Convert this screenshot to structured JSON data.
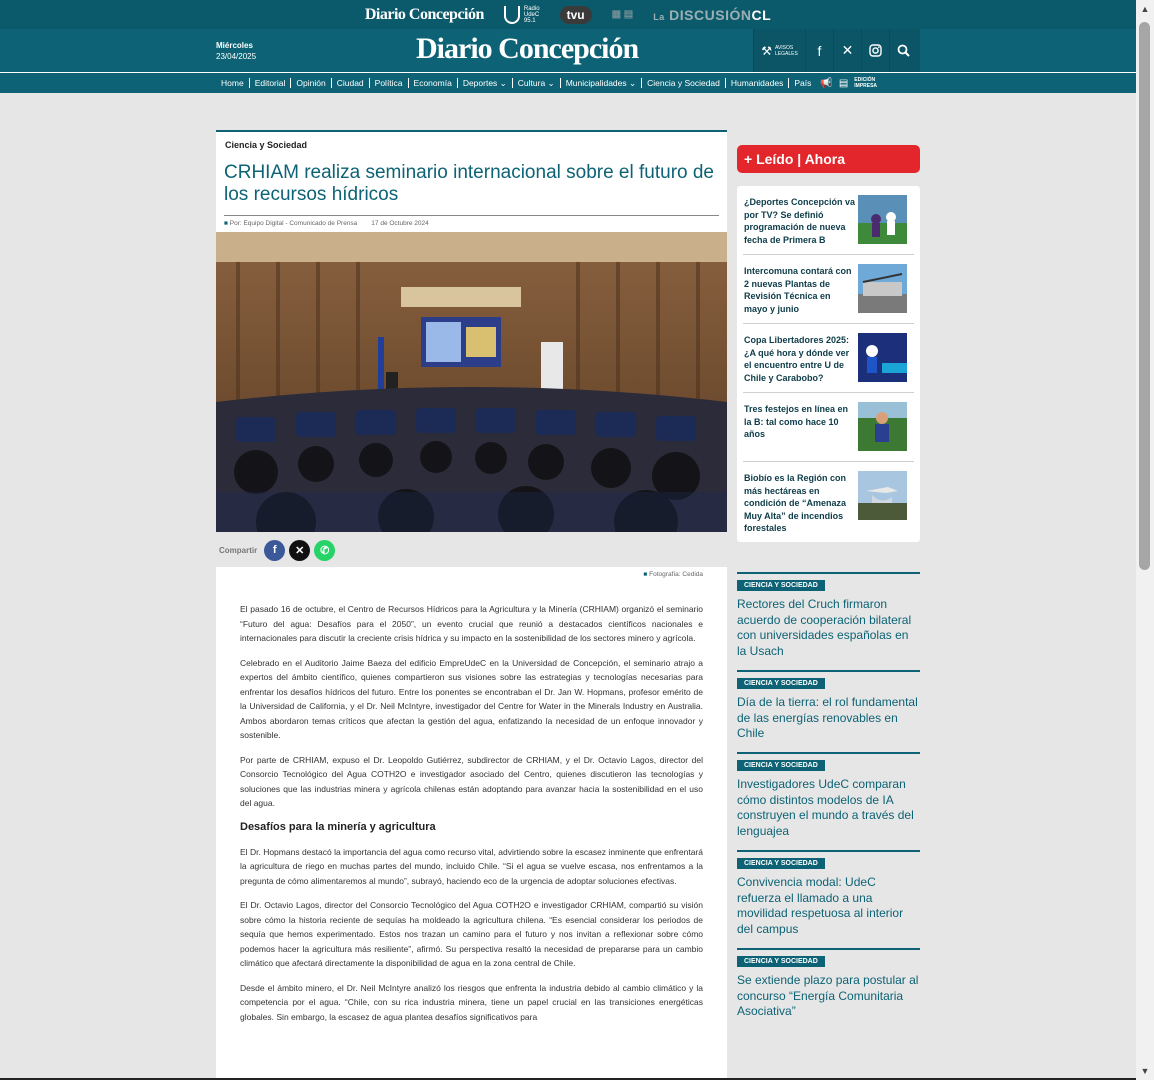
{
  "network": {
    "brand": "Diario Concepción",
    "radio": "Radio UdeC 95.1",
    "radio_l1": "Radio",
    "radio_l2": "UdeC",
    "radio_l3": "95.1",
    "tvu": "tvu",
    "discusion_prefix": "La",
    "discusion_main": "DISCUSIÓN",
    "discusion_suffix": "CL"
  },
  "header": {
    "day": "Miércoles",
    "date": "23/04/2025",
    "logo": "Diario Concepción",
    "avisos_l1": "AVISOS",
    "avisos_l2": "LEGALES"
  },
  "nav": {
    "items": [
      "Home",
      "Editorial",
      "Opinión",
      "Ciudad",
      "Política",
      "Economía",
      "Deportes ⌄",
      "Cultura ⌄",
      "Municipalidades ⌄",
      "Ciencia y Sociedad",
      "Humanidades",
      "País"
    ],
    "edicion_l1": "EDICIÓN",
    "edicion_l2": "IMPRESA"
  },
  "article": {
    "category": "Ciencia y Sociedad",
    "title": "CRHIAM realiza seminario internacional sobre el futuro de los recursos hídricos",
    "author": "Por: Equipo Digital - Comunicado de Prensa",
    "date": "17 de Octubre 2024",
    "share_label": "Compartir",
    "photo_credit": "Fotografía: Cedida",
    "p1": "El pasado 16 de octubre, el Centro de Recursos Hídricos para la Agricultura y la Minería (CRHIAM) organizó el seminario “Futuro del agua: Desafíos para el 2050”, un evento crucial que reunió a destacados científicos nacionales e internacionales para discutir la creciente crisis hídrica y su impacto en la sostenibilidad de los sectores minero y agrícola.",
    "p2": "Celebrado en el Auditorio Jaime Baeza del edificio EmpreUdeC en la Universidad de Concepción, el seminario atrajo a expertos del ámbito científico, quienes compartieron sus visiones sobre las estrategias y tecnologías necesarias para enfrentar los desafíos hídricos del futuro. Entre los ponentes se encontraban el Dr. Jan W. Hopmans, profesor emérito de la Universidad de California, y el Dr. Neil McIntyre, investigador del Centre for Water in the Minerals Industry en Australia. Ambos abordaron temas críticos que afectan la gestión del agua, enfatizando la necesidad de un enfoque innovador y sostenible.",
    "p3": "Por parte de CRHIAM, expuso el Dr. Leopoldo Gutiérrez, subdirector de CRHIAM, y el Dr. Octavio Lagos, director del Consorcio Tecnológico del Agua COTH2O e investigador asociado del Centro, quienes discutieron las tecnologías y soluciones que las industrias minera y agrícola chilenas están adoptando para avanzar hacia la sostenibilidad en el uso del agua.",
    "subheading": "Desafíos para la minería y agricultura",
    "p4": "El Dr. Hopmans destacó la importancia del agua como recurso vital, advirtiendo sobre la escasez inminente que enfrentará la agricultura de riego en muchas partes del mundo, incluido Chile. “Si el agua se vuelve escasa, nos enfrentamos a la pregunta de cómo alimentaremos al mundo”, subrayó, haciendo eco de la urgencia de adoptar soluciones efectivas.",
    "p5": "El Dr. Octavio Lagos, director del Consorcio Tecnológico del Agua COTH2O e investigador CRHIAM, compartió su visión sobre cómo la historia reciente de sequías ha moldeado la agricultura chilena. “Es esencial considerar los periodos de sequía que hemos experimentado. Estos nos trazan un camino para el futuro y nos invitan a reflexionar sobre cómo podemos hacer la agricultura más resiliente”, afirmó. Su perspectiva resaltó la necesidad de prepararse para un cambio climático que afectará directamente la disponibilidad de agua en la zona central de Chile.",
    "p6": "Desde el ámbito minero, el Dr. Neil McIntyre analizó los riesgos que enfrenta la industria debido al cambio climático y la competencia por el agua. “Chile, con su rica industria minera, tiene un papel crucial en las transiciones energéticas globales. Sin embargo, la escasez de agua plantea desafíos significativos para"
  },
  "leido": {
    "label": "+ Leído | Ahora",
    "items": [
      {
        "title": "¿Deportes Concepción va por TV? Se definió programación de nueva fecha de Primera B"
      },
      {
        "title": "Intercomuna contará con 2 nuevas Plantas de Revisión Técnica en mayo y junio"
      },
      {
        "title": "Copa Libertadores 2025: ¿A qué hora y dónde ver el encuentro entre U de Chile y Carabobo?"
      },
      {
        "title": "Tres festejos en línea en la B: tal como hace 10 años"
      },
      {
        "title": "Biobío es la Región con más hectáreas en condición de “Amenaza Muy Alta” de incendios forestales"
      }
    ]
  },
  "related": [
    {
      "tag": "CIENCIA Y SOCIEDAD",
      "title": "Rectores del Cruch firmaron acuerdo de cooperación bilateral con universidades españolas en la Usach"
    },
    {
      "tag": "CIENCIA Y SOCIEDAD",
      "title": "Día de la tierra: el rol fundamental de las energías renovables en Chile"
    },
    {
      "tag": "CIENCIA Y SOCIEDAD",
      "title": "Investigadores UdeC comparan cómo distintos modelos de IA construyen el mundo a través del lenguajea"
    },
    {
      "tag": "CIENCIA Y SOCIEDAD",
      "title": "Convivencia modal: UdeC refuerza el llamado a una movilidad respetuosa al interior del campus"
    },
    {
      "tag": "CIENCIA Y SOCIEDAD",
      "title": "Se extiende plazo para postular al concurso “Energía Comunitaria Asociativa”"
    }
  ],
  "colors": {
    "brand": "#0d6375",
    "accent": "#e3262b"
  }
}
